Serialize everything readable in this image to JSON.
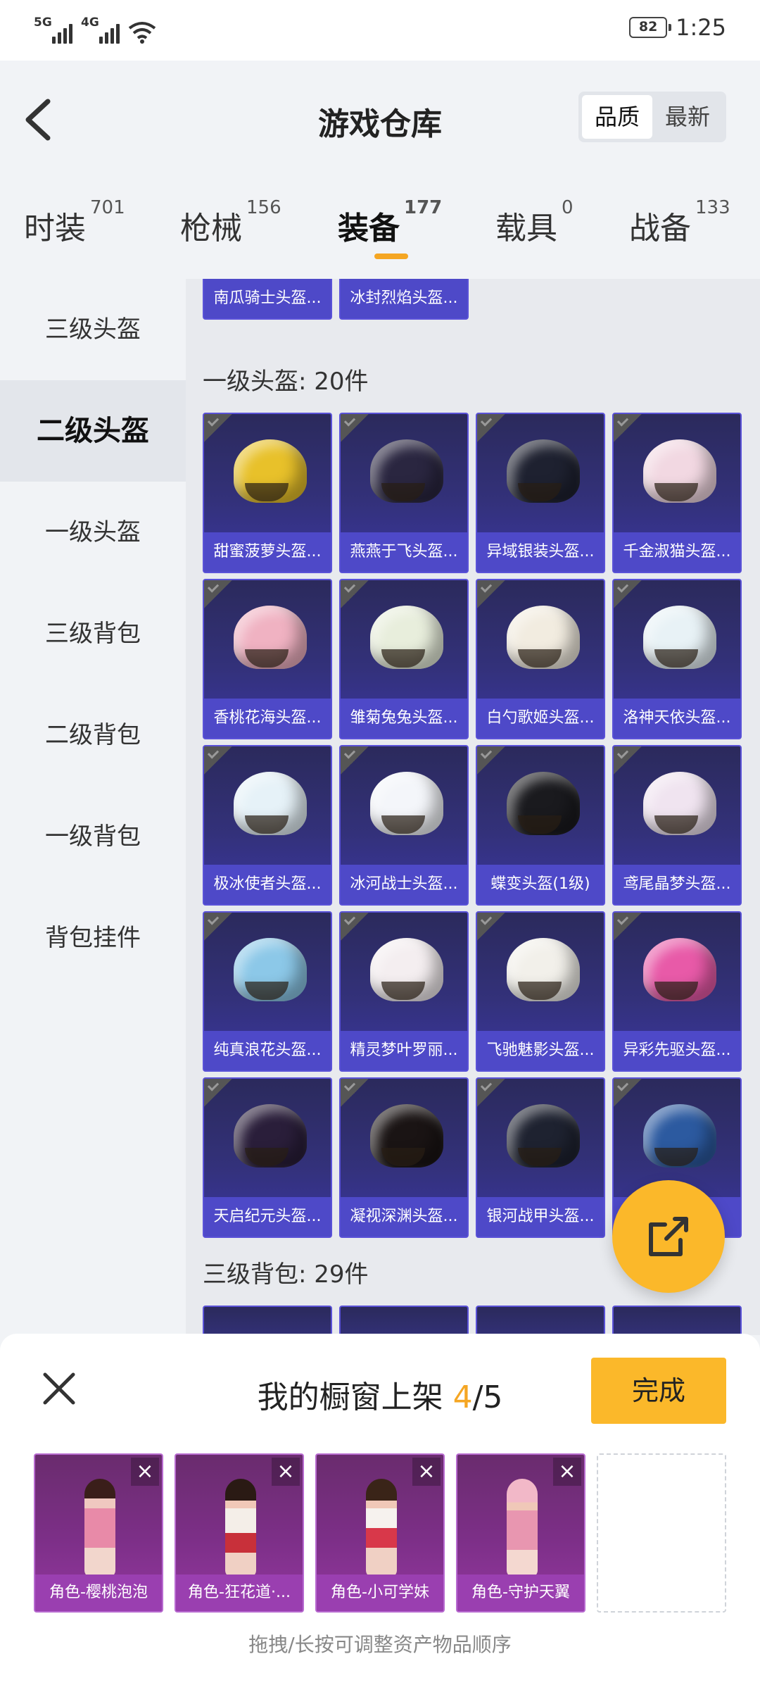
{
  "status_bar": {
    "signal1": "5G",
    "signal2": "4G",
    "battery": "82",
    "time": "1:25"
  },
  "header": {
    "title": "游戏仓库",
    "sort": [
      "品质",
      "最新"
    ]
  },
  "tabs": [
    {
      "label": "时装",
      "count": "701"
    },
    {
      "label": "枪械",
      "count": "156"
    },
    {
      "label": "装备",
      "count": "177"
    },
    {
      "label": "载具",
      "count": "0"
    },
    {
      "label": "战备",
      "count": "133"
    }
  ],
  "sidebar": [
    "三级头盔",
    "二级头盔",
    "一级头盔",
    "三级背包",
    "二级背包",
    "一级背包",
    "背包挂件"
  ],
  "partial_items": [
    "南瓜骑士头盔...",
    "冰封烈焰头盔..."
  ],
  "section1": {
    "title": "一级头盔: 20件"
  },
  "items": [
    "甜蜜菠萝头盔...",
    "燕燕于飞头盔...",
    "异域银装头盔...",
    "千金淑猫头盔...",
    "香桃花海头盔...",
    "雏菊兔兔头盔...",
    "白勺歌姬头盔...",
    "洛神天依头盔...",
    "极冰使者头盔...",
    "冰河战士头盔...",
    "蝶变头盔(1级)",
    "鸢尾晶梦头盔...",
    "纯真浪花头盔...",
    "精灵梦叶罗丽...",
    "飞驰魅影头盔...",
    "异彩先驱头盔...",
    "天启纪元头盔...",
    "凝视深渊头盔...",
    "银河战甲头盔...",
    "..."
  ],
  "helmet_colors": [
    "#e8c12a",
    "#2a2640",
    "#1e2130",
    "#f2d8e2",
    "#f0b2c2",
    "#e8eedc",
    "#f2ece0",
    "#e8f2f6",
    "#e6f2f8",
    "#f4f6fa",
    "#1a1a1e",
    "#f0e4f0",
    "#8cc8e8",
    "#f4eef0",
    "#f2f0ea",
    "#e85aa8",
    "#2a1e3a",
    "#1a1414",
    "#1e2230",
    "#2c5aa0"
  ],
  "section2": {
    "title": "三级背包: 29件"
  },
  "sheet": {
    "title_prefix": "我的橱窗上架 ",
    "count": "4",
    "total": "/5",
    "done": "完成",
    "slots": [
      "角色-樱桃泡泡",
      "角色-狂花道·...",
      "角色-小可学妹",
      "角色-守护天翼"
    ],
    "hint": "拖拽/长按可调整资产物品顺序"
  }
}
